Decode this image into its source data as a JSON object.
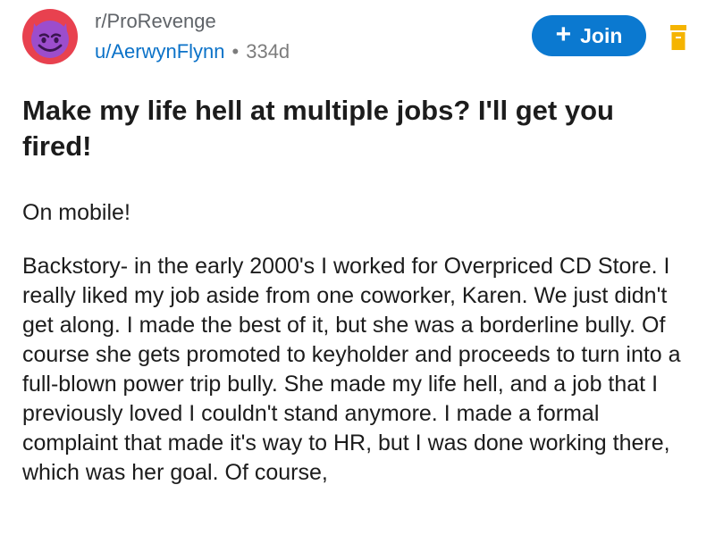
{
  "post": {
    "subreddit": "r/ProRevenge",
    "username": "u/AerwynFlynn",
    "separator": "•",
    "age": "334d",
    "join_label": "Join",
    "join_plus": "+",
    "title": "Make my life hell at multiple jobs? I'll get you fired!",
    "paragraphs": [
      "On mobile!",
      "Backstory- in the early 2000's I worked for Overpriced CD Store. I really liked my job aside from one coworker, Karen. We just didn't get along. I made the best of it, but she was a borderline bully. Of course she gets promoted to keyholder and proceeds to turn into a full-blown power trip bully. She made my life hell, and a job that I previously loved I couldn't stand anymore. I made a formal complaint that made it's way to HR, but I was done working there, which was her goal. Of course,"
    ]
  },
  "icons": {
    "avatar": "devil-face-icon",
    "archive": "archive-icon"
  },
  "colors": {
    "join_button": "#0b79d0",
    "username": "#0b72c8",
    "archive": "#f5b400",
    "avatar_ring": "#e8414f",
    "avatar_face": "#9c4dcc"
  }
}
